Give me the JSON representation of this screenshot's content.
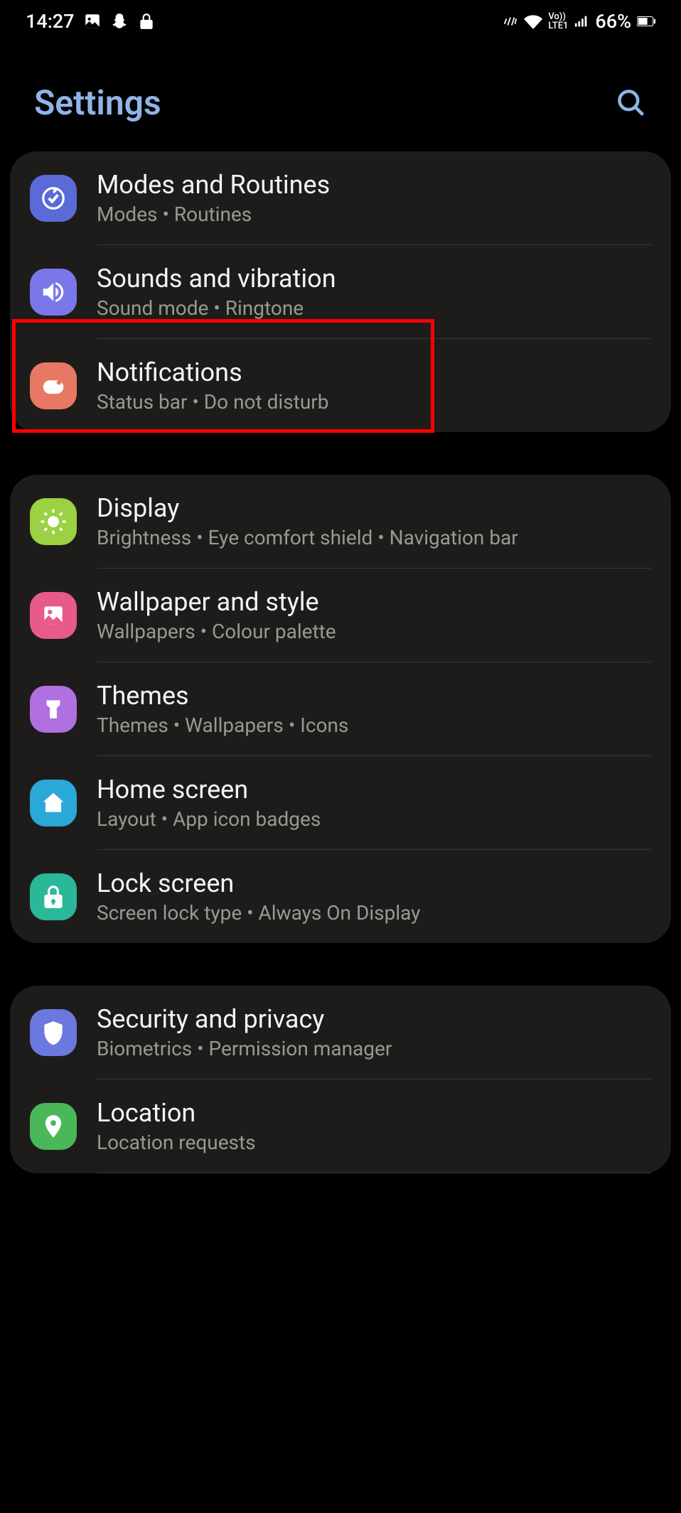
{
  "status_bar": {
    "time": "14:27",
    "battery": "66%"
  },
  "header": {
    "title": "Settings"
  },
  "sections": [
    {
      "items": [
        {
          "title": "Modes and Routines",
          "subtitle": "Modes  •  Routines",
          "icon_color": "#5a6bd8"
        },
        {
          "title": "Sounds and vibration",
          "subtitle": "Sound mode  •  Ringtone",
          "icon_color": "#7a78e8"
        },
        {
          "title": "Notifications",
          "subtitle": "Status bar  •  Do not disturb",
          "icon_color": "#e87864"
        }
      ]
    },
    {
      "items": [
        {
          "title": "Display",
          "subtitle": "Brightness  •  Eye comfort shield  •  Navigation bar",
          "icon_color": "#9bd142"
        },
        {
          "title": "Wallpaper and style",
          "subtitle": "Wallpapers  •  Colour palette",
          "icon_color": "#e85a8a"
        },
        {
          "title": "Themes",
          "subtitle": "Themes  •  Wallpapers  •  Icons",
          "icon_color": "#b070e0"
        },
        {
          "title": "Home screen",
          "subtitle": "Layout  •  App icon badges",
          "icon_color": "#2aa8d8"
        },
        {
          "title": "Lock screen",
          "subtitle": "Screen lock type  •  Always On Display",
          "icon_color": "#2ab898"
        }
      ]
    },
    {
      "items": [
        {
          "title": "Security and privacy",
          "subtitle": "Biometrics  •  Permission manager",
          "icon_color": "#6a78e0"
        },
        {
          "title": "Location",
          "subtitle": "Location requests",
          "icon_color": "#4ab858"
        }
      ]
    }
  ]
}
